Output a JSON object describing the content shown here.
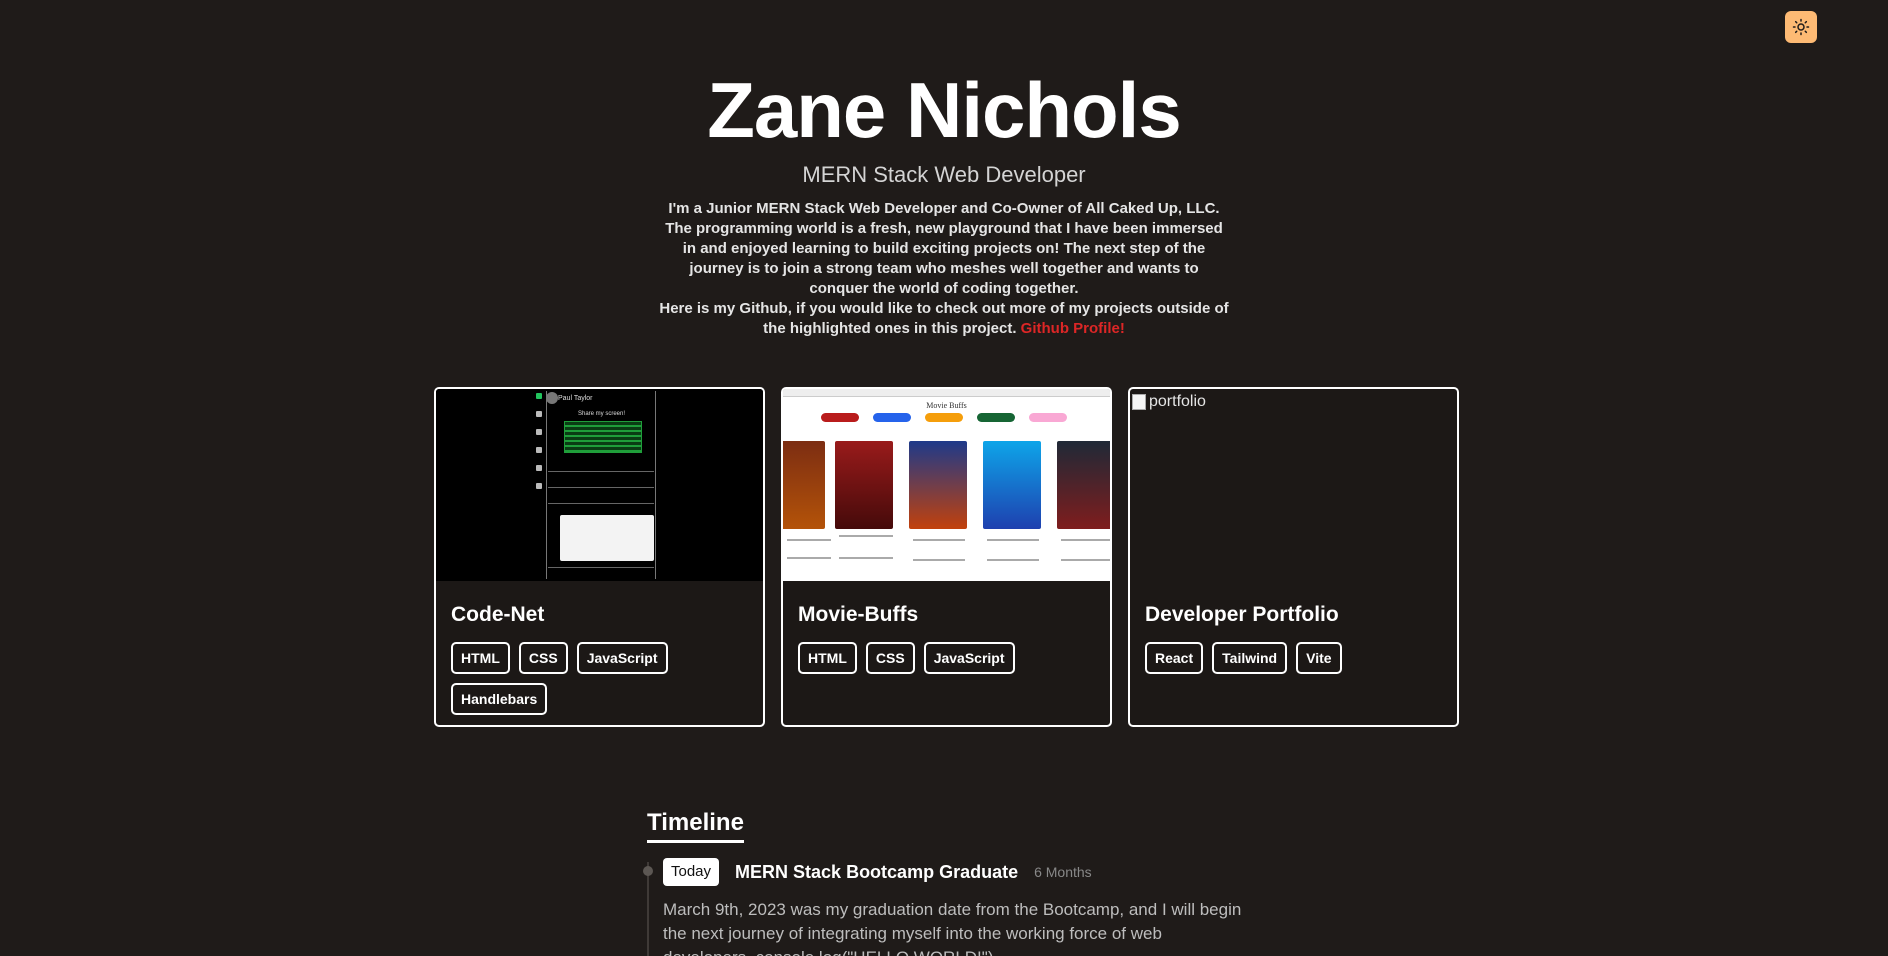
{
  "header": {
    "name": "Zane Nichols",
    "title": "MERN Stack Web Developer",
    "bio": "I'm a Junior MERN Stack Web Developer and Co-Owner of All Caked Up, LLC. The programming world is a fresh, new playground that I have been immersed in and enjoyed learning to build exciting projects on! The next step of the journey is to join a strong team who meshes well together and wants to conquer the world of coding together.",
    "github_text": "Here is my Github, if you would like to check out more of my projects outside of the highlighted ones in this project.",
    "github_link": "Github Profile!"
  },
  "theme_toggle": {
    "icon": "sun-icon",
    "color": "#fdba74"
  },
  "accent_link_color": "#dc2626",
  "projects": [
    {
      "title": "Code-Net",
      "tags": [
        "HTML",
        "CSS",
        "JavaScript",
        "Handlebars"
      ],
      "screenshot_user": "Paul Taylor",
      "screenshot_heading": "Share my screen!"
    },
    {
      "title": "Movie-Buffs",
      "tags": [
        "HTML",
        "CSS",
        "JavaScript"
      ],
      "screenshot_heading": "Movie Buffs"
    },
    {
      "title": "Developer Portfolio",
      "tags": [
        "React",
        "Tailwind",
        "Vite"
      ],
      "image_alt": "portfolio"
    }
  ],
  "timeline": {
    "heading": "Timeline",
    "items": [
      {
        "badge": "Today",
        "title": "MERN Stack Bootcamp Graduate",
        "duration": "6 Months",
        "description": "March 9th, 2023 was my graduation date from the Bootcamp, and I will begin the next journey of integrating myself into the working force of web developers. console.log(\"HELLO WORLD!\")"
      }
    ]
  }
}
